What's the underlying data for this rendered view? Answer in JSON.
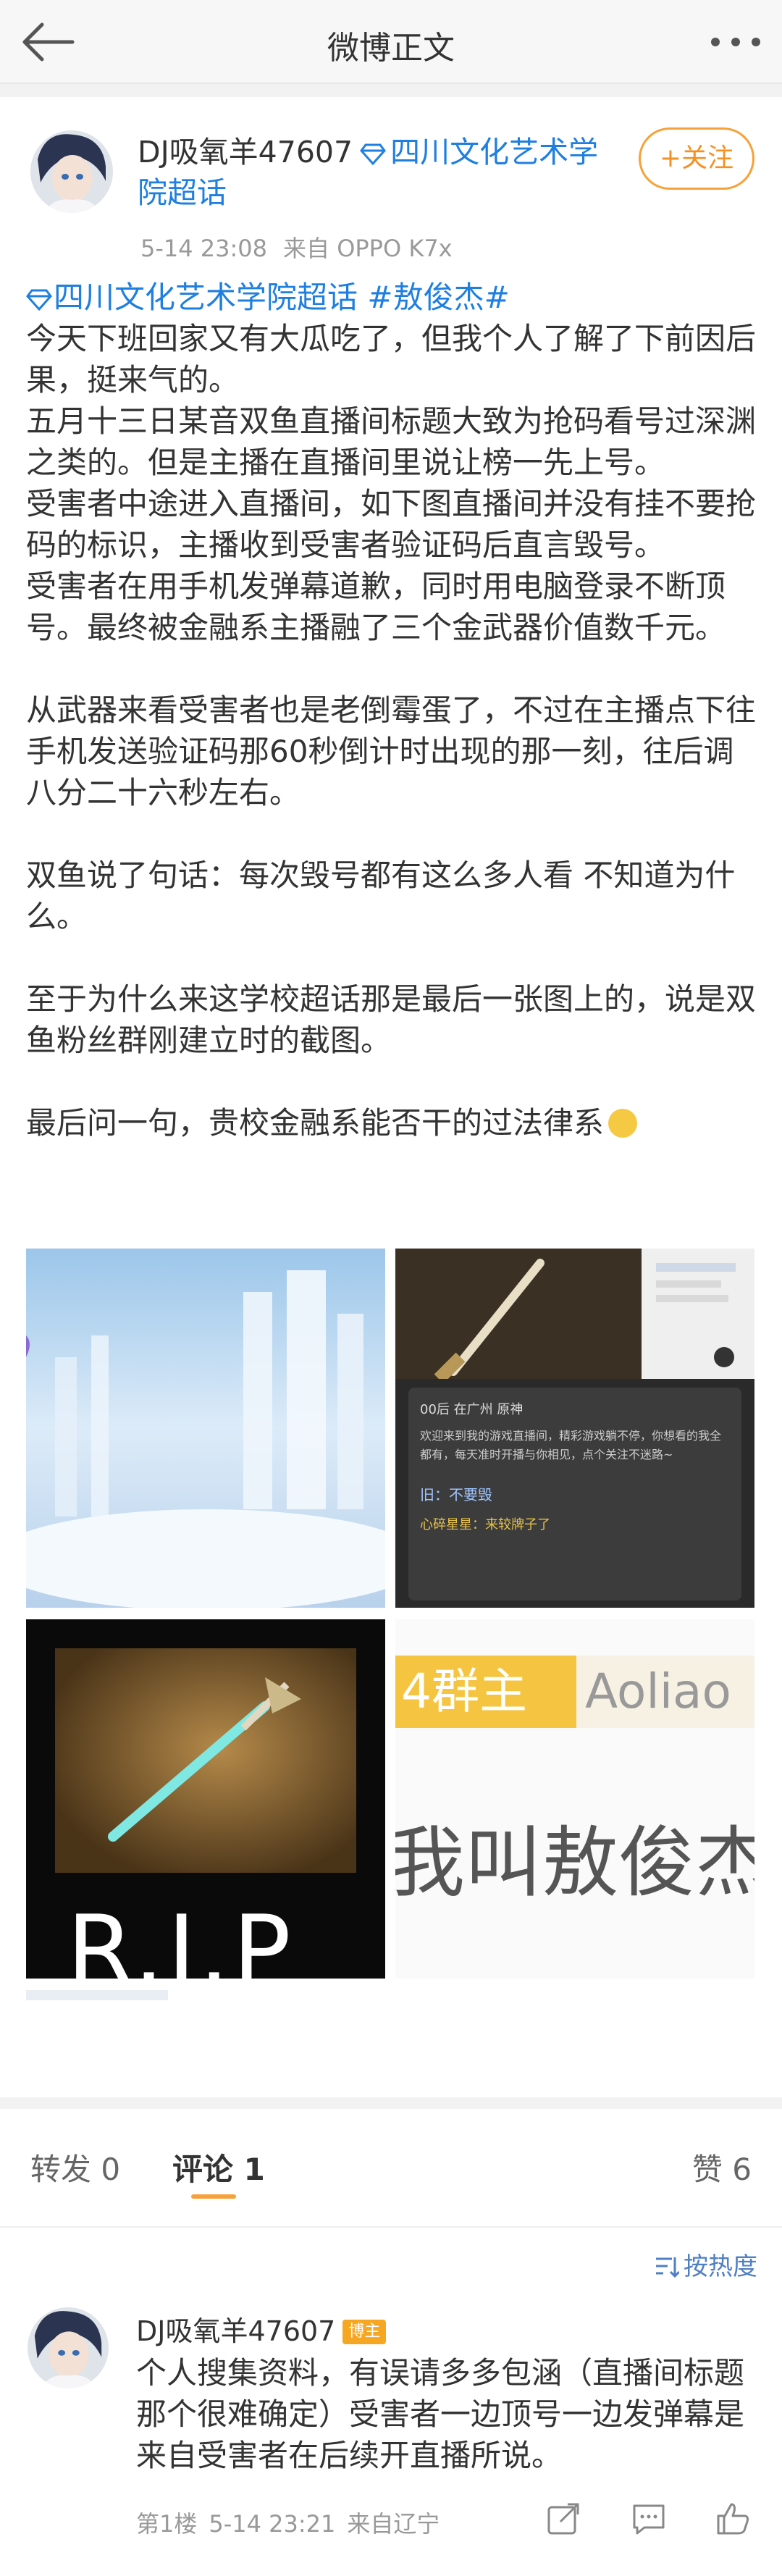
{
  "header": {
    "title": "微博正文"
  },
  "post": {
    "author": "DJ吸氧羊47607",
    "supertopic_link": "四川文化艺术学院超话",
    "time": "5-14 23:08",
    "source": "来自 OPPO K7x",
    "follow_label": "+关注",
    "tag_topic": "四川文化艺术学院超话",
    "tag_hash": "#敖俊杰#",
    "paragraphs": [
      "今天下班回家又有大瓜吃了，但我个人了解了下前因后果，挺来气的。",
      "五月十三日某音双鱼直播间标题大致为抢码看号过深渊之类的。但是主播在直播间里说让榜一先上号。",
      "受害者中途进入直播间，如下图直播间并没有挂不要抢码的标识，主播收到受害者验证码后直言毁号。",
      "受害者在用手机发弹幕道歉，同时用电脑登录不断顶号。最终被金融系主播融了三个金武器价值数千元。",
      "",
      "从武器来看受害者也是老倒霉蛋了，不过在主播点下往手机发送验证码那60秒倒计时出现的那一刻，往后调八分二十六秒左右。",
      "",
      "双鱼说了句话：每次毁号都有这么多人看 不知道为什么。",
      "",
      "至于为什么来这学校超话那是最后一张图上的，说是双鱼粉丝群刚建立时的截图。",
      "",
      "最后问一句，贵校金融系能否干的过法律系"
    ],
    "images": {
      "chat_text_1": "欢迎来到我的游戏直播间，精彩游戏躺不停，你想看的我全都有，每天准时开播与你相见，点个关注不迷路~",
      "chat_text_2": "旧：不要毁",
      "chat_text_3": "心碎星星：来较牌子了",
      "chat_user": "00后 在广州 原神",
      "rip_text": "R.I.P",
      "badge_left": "4群主",
      "badge_right": "Aoliao",
      "big_name": "我叫敖俊杰"
    }
  },
  "actions": {
    "repost": "转发 0",
    "comment": "评论 1",
    "like": "赞 6"
  },
  "comments": {
    "sort_label": "按热度",
    "items": [
      {
        "author": "DJ吸氧羊47607",
        "badge": "博主",
        "text": "个人搜集资料，有误请多多包涵（直播间标题那个很难确定）受害者一边顶号一边发弹幕是来自受害者在后续开直播所说。",
        "floor": "第1楼",
        "time": "5-14 23:21",
        "location": "来自辽宁"
      }
    ]
  }
}
